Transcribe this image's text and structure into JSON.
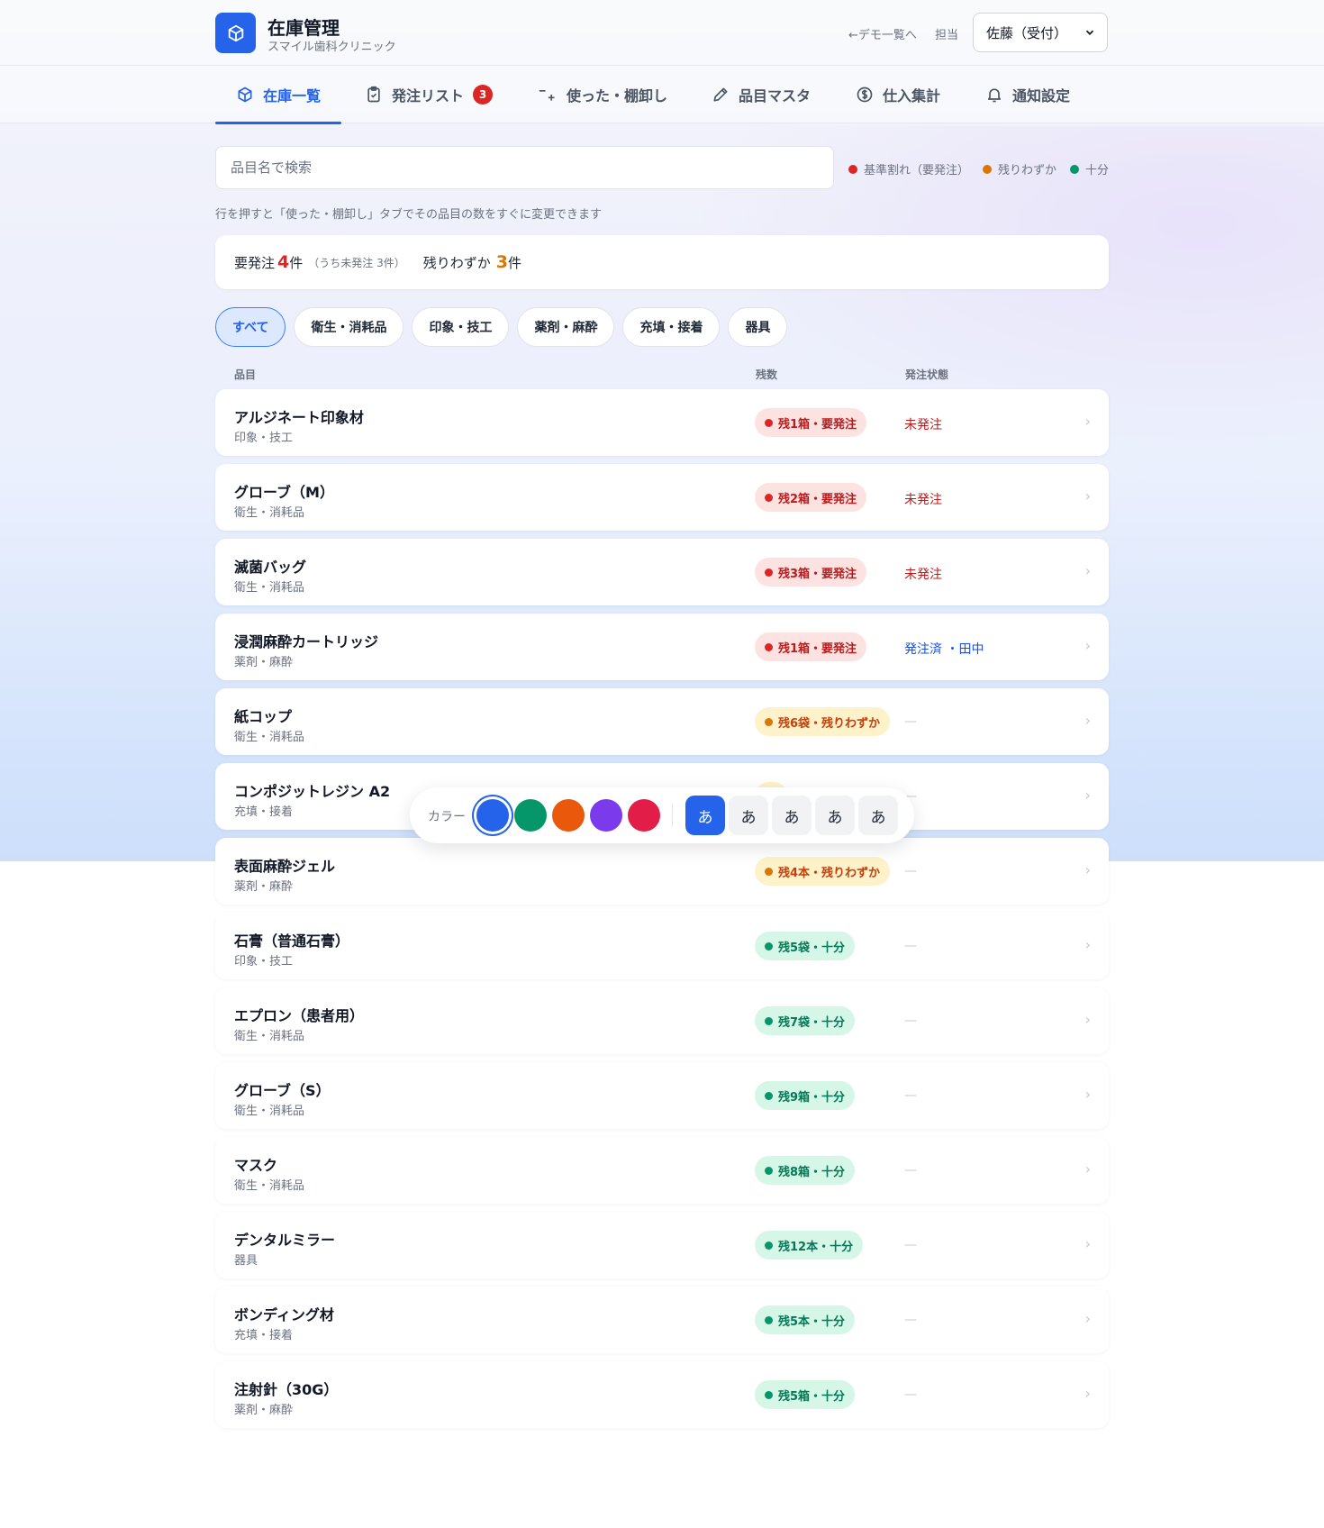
{
  "header": {
    "title": "在庫管理",
    "subtitle": "スマイル歯科クリニック",
    "back_link": "←デモ一覧へ",
    "staff_label": "担当",
    "staff_selected": "佐藤（受付）"
  },
  "tabs": [
    {
      "label": "在庫一覧",
      "icon": "box-icon",
      "active": true
    },
    {
      "label": "発注リスト",
      "icon": "clipboard-check-icon",
      "badge": "3"
    },
    {
      "label": "使った・棚卸し",
      "icon": "minus-plus-icon"
    },
    {
      "label": "品目マスタ",
      "icon": "pencil-icon"
    },
    {
      "label": "仕入集計",
      "icon": "coin-icon"
    },
    {
      "label": "通知設定",
      "icon": "bell-icon"
    }
  ],
  "search": {
    "placeholder": "品目名で検索"
  },
  "legend": [
    {
      "label": "基準割れ（要発注）",
      "color": "#dc2626"
    },
    {
      "label": "残りわずか",
      "color": "#d97706"
    },
    {
      "label": "十分",
      "color": "#059669"
    }
  ],
  "hint": "行を押すと「使った・棚卸し」タブでその品目の数をすぐに変更できます",
  "summary": {
    "need_order_label": "要発注",
    "need_order_count": "4",
    "need_order_unit": "件",
    "need_order_note": "（うち未発注 3件）",
    "low_label": "残りわずか",
    "low_count": "3",
    "low_unit": "件"
  },
  "filters": [
    {
      "label": "すべて",
      "active": true
    },
    {
      "label": "衛生・消耗品"
    },
    {
      "label": "印象・技工"
    },
    {
      "label": "薬剤・麻酔"
    },
    {
      "label": "充填・接着"
    },
    {
      "label": "器具"
    }
  ],
  "columns": {
    "item": "品目",
    "stock": "残数",
    "order_status": "発注状態"
  },
  "items": [
    {
      "name": "アルジネート印象材",
      "category": "印象・技工",
      "stock": "残1箱・要発注",
      "level": "red",
      "order": "未発注",
      "order_style": "red"
    },
    {
      "name": "グローブ（M）",
      "category": "衛生・消耗品",
      "stock": "残2箱・要発注",
      "level": "red",
      "order": "未発注",
      "order_style": "red"
    },
    {
      "name": "滅菌バッグ",
      "category": "衛生・消耗品",
      "stock": "残3箱・要発注",
      "level": "red",
      "order": "未発注",
      "order_style": "red"
    },
    {
      "name": "浸潤麻酔カートリッジ",
      "category": "薬剤・麻酔",
      "stock": "残1箱・要発注",
      "level": "red",
      "order": "発注済 ・田中",
      "order_style": "blue"
    },
    {
      "name": "紙コップ",
      "category": "衛生・消耗品",
      "stock": "残6袋・残りわずか",
      "level": "orange",
      "order": "—",
      "order_style": "dash"
    },
    {
      "name": "コンポジットレジン A2",
      "category": "充填・接着",
      "stock": "",
      "level": "orange",
      "order": "—",
      "order_style": "dash"
    },
    {
      "name": "表面麻酔ジェル",
      "category": "薬剤・麻酔",
      "stock": "残4本・残りわずか",
      "level": "orange",
      "order": "—",
      "order_style": "dash"
    },
    {
      "name": "石膏（普通石膏）",
      "category": "印象・技工",
      "stock": "残5袋・十分",
      "level": "green",
      "order": "—",
      "order_style": "dash"
    },
    {
      "name": "エプロン（患者用）",
      "category": "衛生・消耗品",
      "stock": "残7袋・十分",
      "level": "green",
      "order": "—",
      "order_style": "dash"
    },
    {
      "name": "グローブ（S）",
      "category": "衛生・消耗品",
      "stock": "残9箱・十分",
      "level": "green",
      "order": "—",
      "order_style": "dash"
    },
    {
      "name": "マスク",
      "category": "衛生・消耗品",
      "stock": "残8箱・十分",
      "level": "green",
      "order": "—",
      "order_style": "dash"
    },
    {
      "name": "デンタルミラー",
      "category": "器具",
      "stock": "残12本・十分",
      "level": "green",
      "order": "—",
      "order_style": "dash"
    },
    {
      "name": "ボンディング材",
      "category": "充填・接着",
      "stock": "残5本・十分",
      "level": "green",
      "order": "—",
      "order_style": "dash"
    },
    {
      "name": "注射針（30G）",
      "category": "薬剤・麻酔",
      "stock": "残5箱・十分",
      "level": "green",
      "order": "—",
      "order_style": "dash"
    }
  ],
  "chevron": "›",
  "palette": {
    "label": "カラー",
    "colors": [
      "#2563eb",
      "#059669",
      "#ea580c",
      "#7c3aed",
      "#e11d48"
    ],
    "selected_color": "#2563eb",
    "font_buttons": [
      "あ",
      "あ",
      "あ",
      "あ",
      "あ"
    ]
  }
}
